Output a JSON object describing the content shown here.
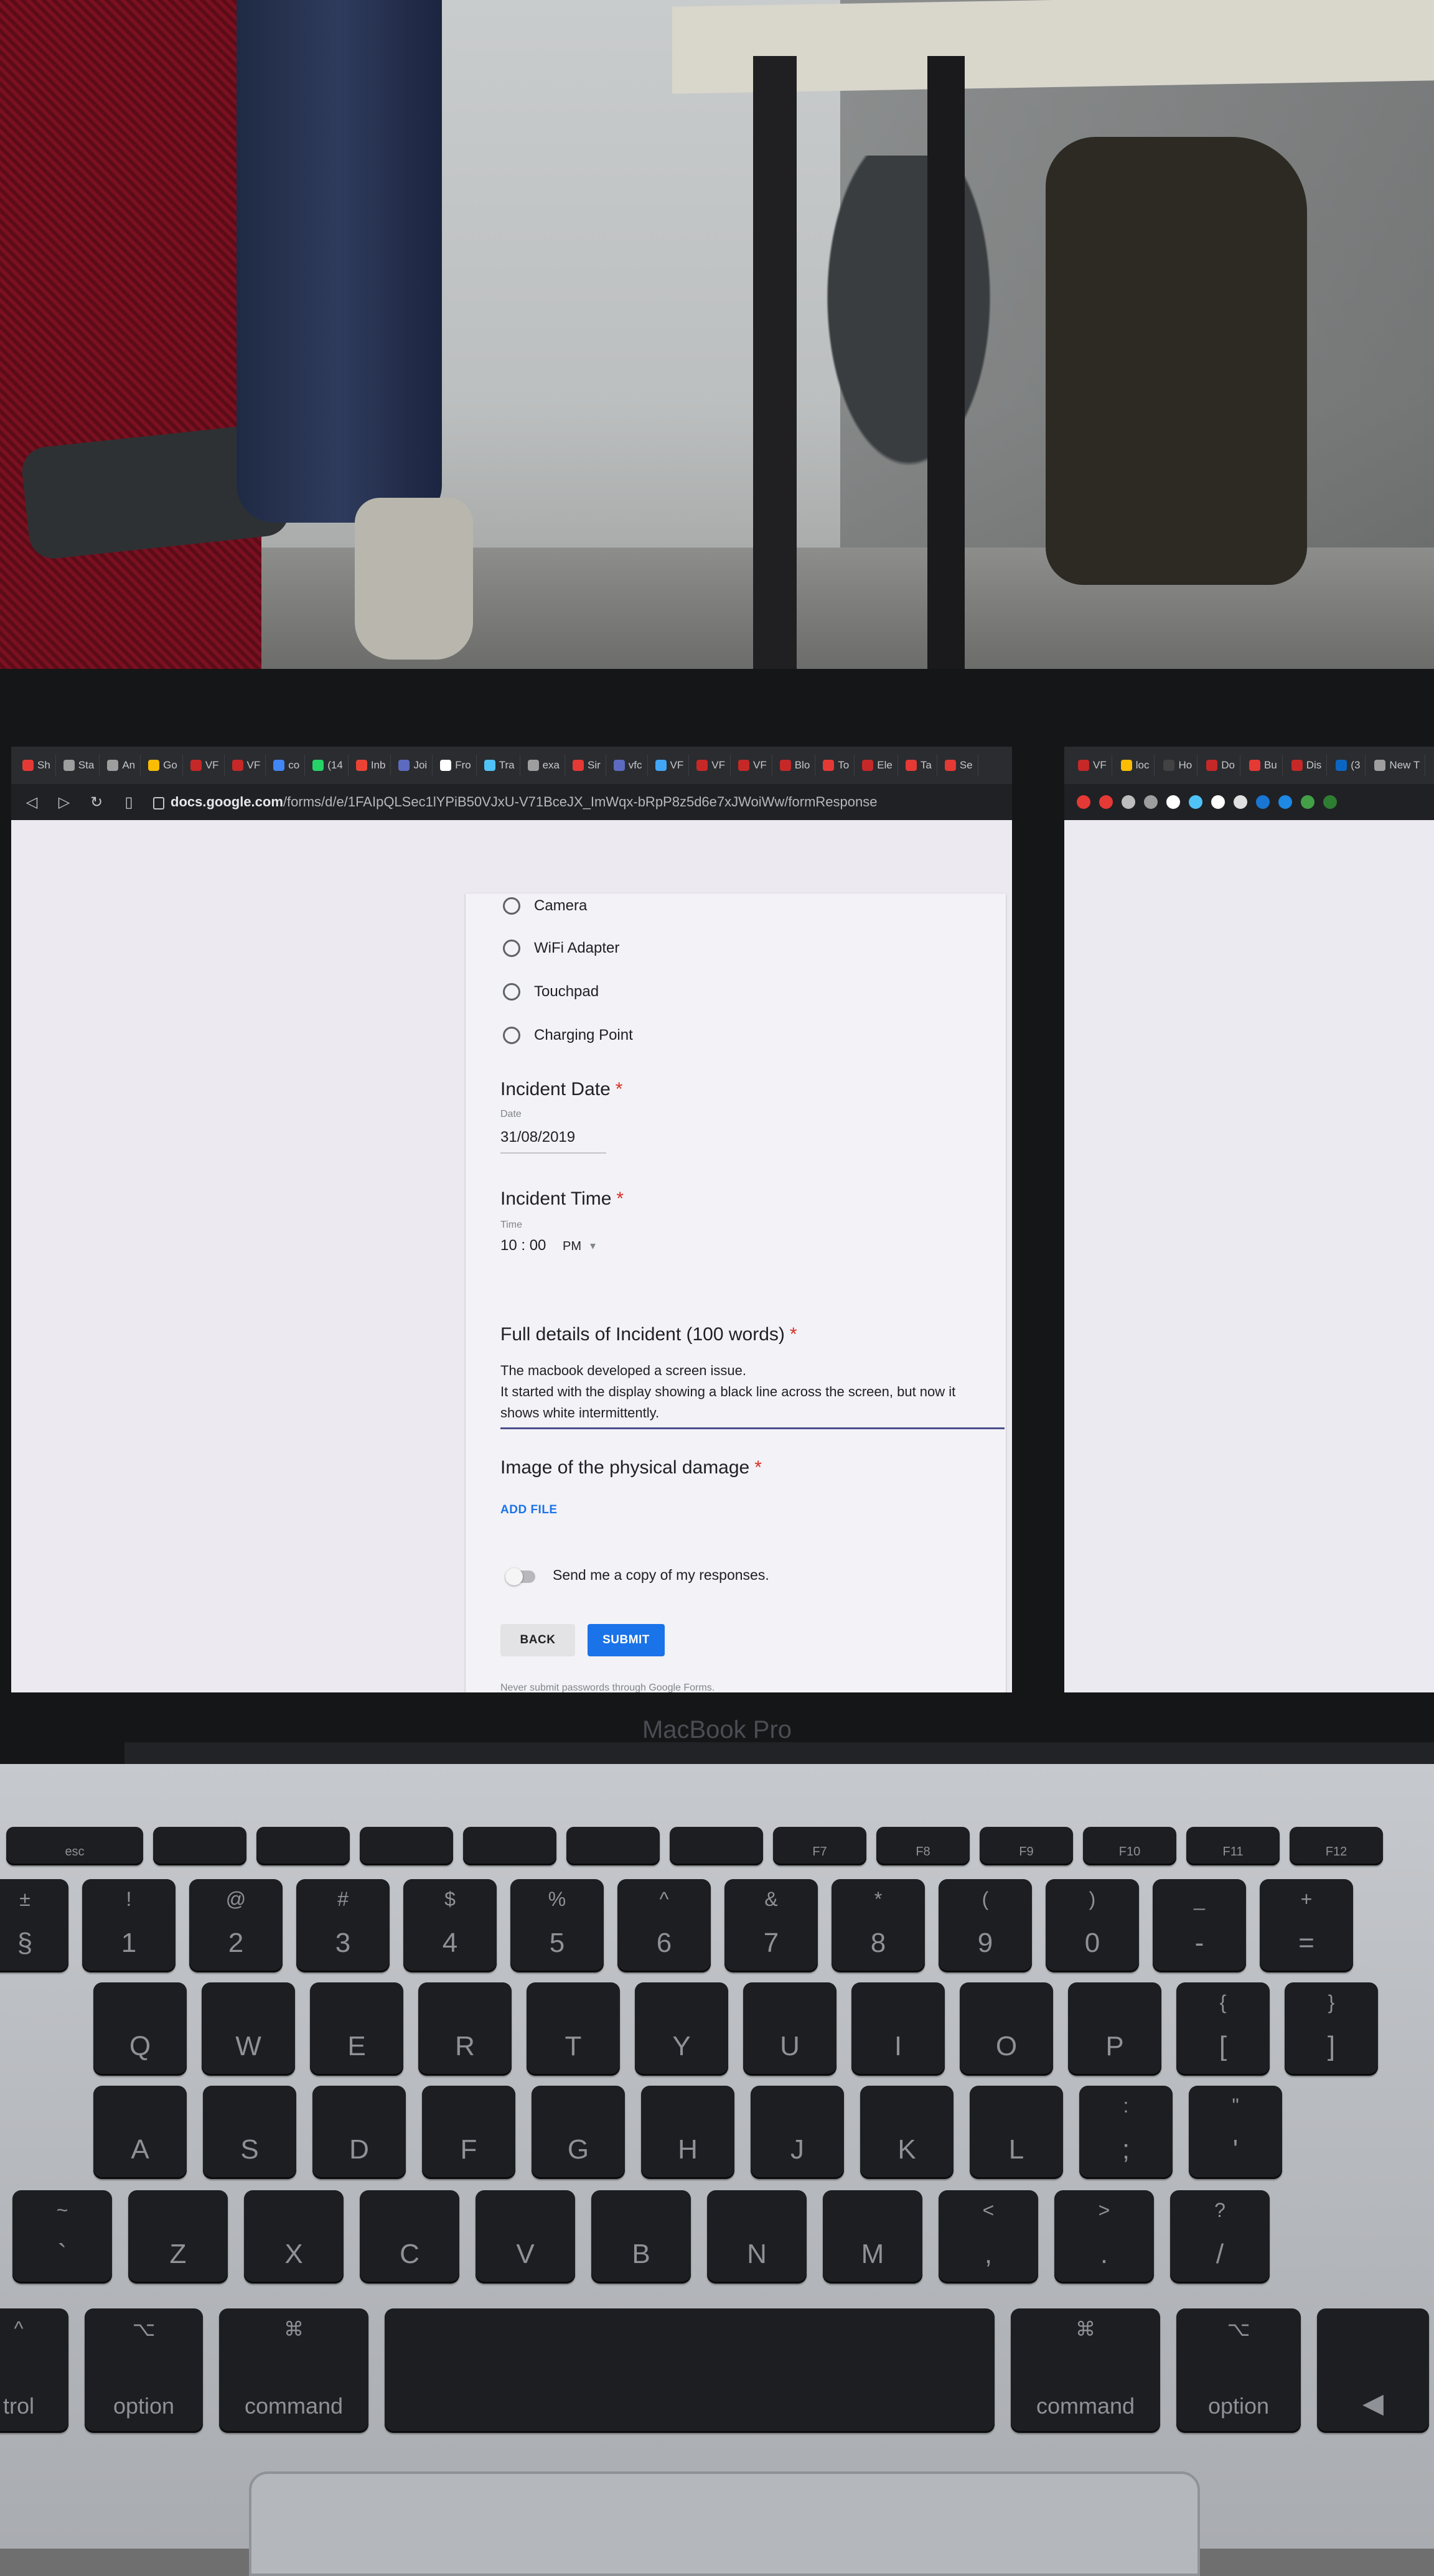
{
  "browser": {
    "tabs": [
      {
        "label": "Sh",
        "color": "#e53935"
      },
      {
        "label": "Sta",
        "color": "#9e9e9e"
      },
      {
        "label": "An",
        "color": "#9e9e9e"
      },
      {
        "label": "Go",
        "color": "#fbbc04"
      },
      {
        "label": "VF",
        "color": "#c62828"
      },
      {
        "label": "VF",
        "color": "#c62828"
      },
      {
        "label": "co",
        "color": "#4285f4"
      },
      {
        "label": "(14",
        "color": "#25d366"
      },
      {
        "label": "Inb",
        "color": "#ea4335"
      },
      {
        "label": "Joi",
        "color": "#5c6bc0"
      },
      {
        "label": "Fro",
        "color": "#ffffff"
      },
      {
        "label": "Tra",
        "color": "#4fc3f7"
      },
      {
        "label": "exa",
        "color": "#9e9e9e"
      },
      {
        "label": "Sir",
        "color": "#e53935"
      },
      {
        "label": "vfc",
        "color": "#5c6bc0"
      },
      {
        "label": "VF",
        "color": "#42a5f5"
      },
      {
        "label": "VF",
        "color": "#c62828"
      },
      {
        "label": "VF",
        "color": "#c62828"
      },
      {
        "label": "Blo",
        "color": "#c62828"
      },
      {
        "label": "To",
        "color": "#e53935"
      },
      {
        "label": "Ele",
        "color": "#c62828"
      },
      {
        "label": "Ta",
        "color": "#e53935"
      },
      {
        "label": "Se",
        "color": "#e53935"
      }
    ],
    "url_domain": "docs.google.com",
    "url_path": "/forms/d/e/1FAIpQLSec1lYPiB50VJxU-V71BceJX_ImWqx-bRpP8z5d6e7xJWoiWw/formResponse"
  },
  "right_browser": {
    "tabs": [
      {
        "label": "VF",
        "color": "#c62828"
      },
      {
        "label": "loc",
        "color": "#fbbc04"
      },
      {
        "label": "Ho",
        "color": "#424242"
      },
      {
        "label": "Do",
        "color": "#c62828"
      },
      {
        "label": "Bu",
        "color": "#e53935"
      },
      {
        "label": "Dis",
        "color": "#c62828"
      },
      {
        "label": "(3",
        "color": "#0a66c2"
      },
      {
        "label": "New T",
        "color": "#9e9e9e"
      }
    ],
    "extensions": [
      "#e53935",
      "#e53935",
      "#bdbdbd",
      "#9e9e9e",
      "#ffffff",
      "#4fc3f7",
      "#ffffff",
      "#e0e0e0",
      "#1976d2",
      "#1e88e5",
      "#43a047",
      "#2e7d32"
    ]
  },
  "form": {
    "options": [
      "Camera",
      "WiFi Adapter",
      "Touchpad",
      "Charging Point"
    ],
    "date_question": {
      "title": "Incident Date",
      "sublabel": "Date",
      "value": "31/08/2019"
    },
    "time_question": {
      "title": "Incident Time",
      "sublabel": "Time",
      "value": "10 : 00",
      "ampm": "PM"
    },
    "details_question": {
      "title": "Full details of Incident (100 words)",
      "value": "The macbook developed a screen issue.\nIt started with the display showing a black line across the screen, but now it\nshows white intermittently."
    },
    "image_question": {
      "title": "Image of the physical damage"
    },
    "add_file_label": "ADD FILE",
    "send_copy_label": "Send me a copy of my responses.",
    "back_label": "BACK",
    "submit_label": "SUBMIT",
    "footer_note": "Never submit passwords through Google Forms.",
    "required_marker": "*"
  },
  "laptop": {
    "brand": "MacBook Pro"
  },
  "keyboard": {
    "row0": [
      {
        "main": "esc"
      },
      {
        "main": ""
      },
      {
        "main": ""
      },
      {
        "main": ""
      },
      {
        "main": ""
      },
      {
        "main": ""
      },
      {
        "main": ""
      },
      {
        "main": "F7"
      },
      {
        "main": "F8"
      },
      {
        "main": "F9"
      },
      {
        "main": "F10"
      },
      {
        "main": "F11"
      },
      {
        "main": "F12"
      }
    ],
    "row1": [
      {
        "top": "±",
        "main": "§"
      },
      {
        "top": "!",
        "main": "1"
      },
      {
        "top": "@",
        "main": "2"
      },
      {
        "top": "#",
        "main": "3"
      },
      {
        "top": "$",
        "main": "4"
      },
      {
        "top": "%",
        "main": "5"
      },
      {
        "top": "^",
        "main": "6"
      },
      {
        "top": "&",
        "main": "7"
      },
      {
        "top": "*",
        "main": "8"
      },
      {
        "top": "(",
        "main": "9"
      },
      {
        "top": ")",
        "main": "0"
      },
      {
        "top": "_",
        "main": "-"
      },
      {
        "top": "+",
        "main": "="
      }
    ],
    "row2": [
      {
        "main": "Q"
      },
      {
        "main": "W"
      },
      {
        "main": "E"
      },
      {
        "main": "R"
      },
      {
        "main": "T"
      },
      {
        "main": "Y"
      },
      {
        "main": "U"
      },
      {
        "main": "I"
      },
      {
        "main": "O"
      },
      {
        "main": "P"
      },
      {
        "top": "{",
        "main": "["
      },
      {
        "top": "}",
        "main": "]"
      }
    ],
    "row3": [
      {
        "main": "A"
      },
      {
        "main": "S"
      },
      {
        "main": "D"
      },
      {
        "main": "F"
      },
      {
        "main": "G"
      },
      {
        "main": "H"
      },
      {
        "main": "J"
      },
      {
        "main": "K"
      },
      {
        "main": "L"
      },
      {
        "top": ":",
        "main": ";"
      },
      {
        "top": "\"",
        "main": "'"
      }
    ],
    "row4": [
      {
        "top": "~",
        "main": "`"
      },
      {
        "main": "Z"
      },
      {
        "main": "X"
      },
      {
        "main": "C"
      },
      {
        "main": "V"
      },
      {
        "main": "B"
      },
      {
        "main": "N"
      },
      {
        "main": "M"
      },
      {
        "top": "<",
        "main": ","
      },
      {
        "top": ">",
        "main": "."
      },
      {
        "top": "?",
        "main": "/"
      }
    ],
    "row5": [
      {
        "top": "^",
        "main": "trol"
      },
      {
        "top": "⌥",
        "main": "option"
      },
      {
        "top": "⌘",
        "main": "command"
      },
      {
        "main": ""
      },
      {
        "top": "⌘",
        "main": "command"
      },
      {
        "top": "⌥",
        "main": "option"
      },
      {
        "main": "◀"
      }
    ]
  }
}
